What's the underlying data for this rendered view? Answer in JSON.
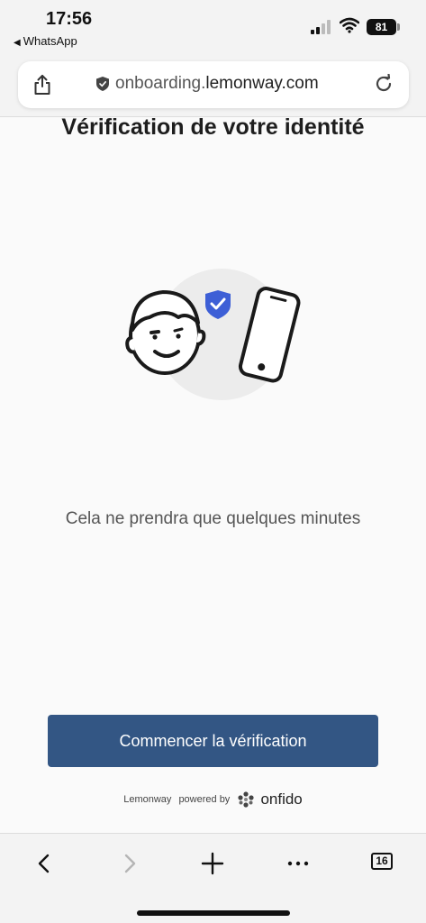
{
  "status_bar": {
    "time": "17:56",
    "back_app": "WhatsApp",
    "back_icon": "back-triangle-icon",
    "battery": "81"
  },
  "browser": {
    "url_prefix": "onboarding.",
    "url_domain": "lemonway.com",
    "tabs_count": "16"
  },
  "main": {
    "title": "Vérification de votre identité",
    "subtitle": "Cela ne prendra que quelques minutes",
    "start_button": "Commencer la vérification",
    "brand": "Lemonway",
    "powered_by": "powered by",
    "onfido": "onfido"
  },
  "colors": {
    "primary_button": "#335684",
    "shield_badge": "#3d5fd6"
  }
}
